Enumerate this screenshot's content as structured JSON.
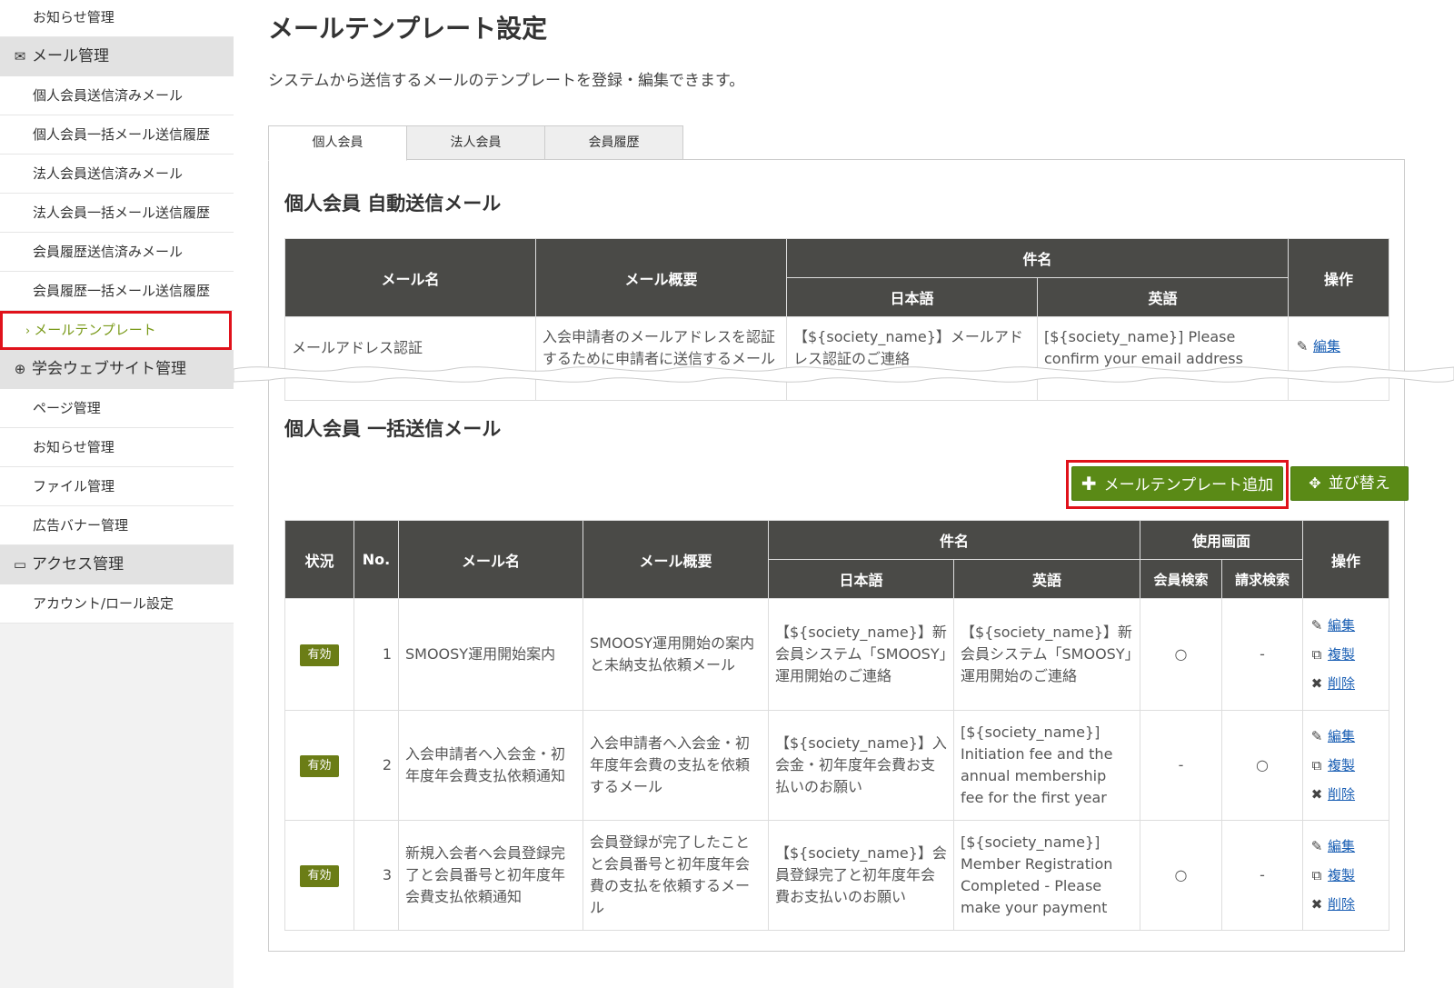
{
  "sidebar": {
    "top_item": "お知らせ管理",
    "mail_section": "メール管理",
    "mail_items": [
      "個人会員送信済みメール",
      "個人会員一括メール送信履歴",
      "法人会員送信済みメール",
      "法人会員一括メール送信履歴",
      "会員履歴送信済みメール",
      "会員履歴一括メール送信履歴"
    ],
    "active_item": "メールテンプレート",
    "web_section": "学会ウェブサイト管理",
    "web_items": [
      "ページ管理",
      "お知らせ管理",
      "ファイル管理",
      "広告バナー管理"
    ],
    "access_section": "アクセス管理",
    "access_items": [
      "アカウント/ロール設定"
    ]
  },
  "page": {
    "title": "メールテンプレート設定",
    "description": "システムから送信するメールのテンプレートを登録・編集できます。"
  },
  "tabs": [
    "個人会員",
    "法人会員",
    "会員履歴"
  ],
  "auto_section": {
    "title": "個人会員 自動送信メール",
    "headers": {
      "mail_name": "メール名",
      "summary": "メール概要",
      "subject": "件名",
      "ja": "日本語",
      "en": "英語",
      "ops": "操作"
    },
    "row": {
      "mail_name": "メールアドレス認証",
      "summary": "入会申請者のメールアドレスを認証するために申請者に送信するメール",
      "ja": "【${society_name}】メールアドレス認証のご連絡",
      "en": "[${society_name}] Please confirm your email address",
      "edit": "編集"
    }
  },
  "bulk_section": {
    "title": "個人会員 一括送信メール",
    "add_button": "メールテンプレート追加",
    "sort_button": "並び替え",
    "headers": {
      "status": "状況",
      "no": "No.",
      "mail_name": "メール名",
      "summary": "メール概要",
      "subject": "件名",
      "ja": "日本語",
      "en": "英語",
      "usage": "使用画面",
      "member_search": "会員検索",
      "billing_search": "請求検索",
      "ops": "操作"
    },
    "ops": {
      "edit": "編集",
      "copy": "複製",
      "delete": "削除"
    },
    "rows": [
      {
        "status": "有効",
        "no": "1",
        "mail_name": "SMOOSY運用開始案内",
        "summary": "SMOOSY運用開始の案内と未納支払依頼メール",
        "ja": "【${society_name}】新会員システム「SMOOSY」運用開始のご連絡",
        "en": "【${society_name}】新会員システム「SMOOSY」運用開始のご連絡",
        "member_search": "○",
        "billing_search": "-"
      },
      {
        "status": "有効",
        "no": "2",
        "mail_name": "入会申請者へ入会金・初年度年会費支払依頼通知",
        "summary": "入会申請者へ入会金・初年度年会費の支払を依頼するメール",
        "ja": "【${society_name}】入会金・初年度年会費お支払いのお願い",
        "en": "[${society_name}] Initiation fee and the annual membership fee for the first year",
        "member_search": "-",
        "billing_search": "○"
      },
      {
        "status": "有効",
        "no": "3",
        "mail_name": "新規入会者へ会員登録完了と会員番号と初年度年会費支払依頼通知",
        "summary": "会員登録が完了したことと会員番号と初年度年会費の支払を依頼するメール",
        "ja": "【${society_name}】会員登録完了と初年度年会費お支払いのお願い",
        "en": "[${society_name}] Member Registration Completed - Please make your payment",
        "member_search": "○",
        "billing_search": "-"
      }
    ]
  },
  "colors": {
    "accent_green": "#5a8a16",
    "highlight_red": "#e0121b",
    "header_dark": "#4a4a47",
    "badge_olive": "#6b7d16",
    "link_blue": "#1a5fb4"
  },
  "icons": {
    "mail": "mail-icon",
    "globe": "globe-icon",
    "monitor": "monitor-icon",
    "pencil": "pencil-icon",
    "copy": "copy-icon",
    "x": "close-icon",
    "plus": "plus-icon",
    "move": "move-icon"
  }
}
